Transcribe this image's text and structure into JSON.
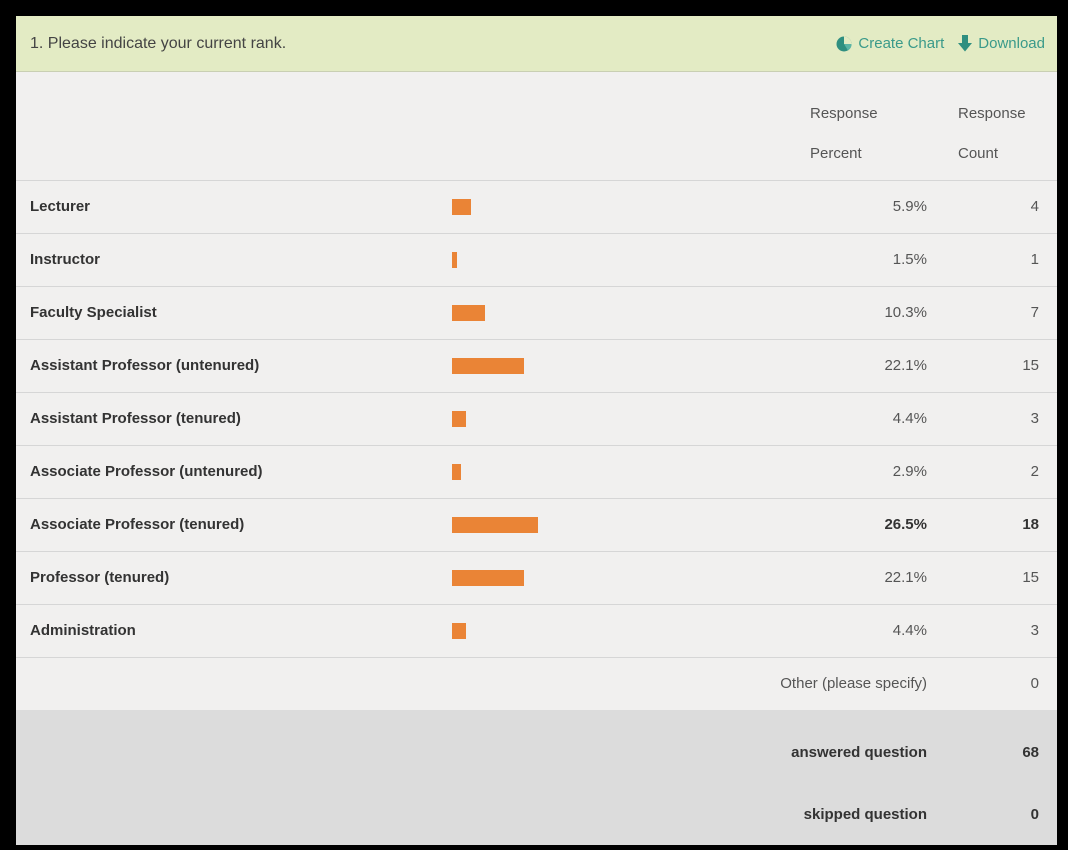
{
  "question": {
    "title": "1. Please indicate your current rank.",
    "actions": {
      "create_chart": "Create Chart",
      "download": "Download"
    }
  },
  "columns": {
    "percent_line1": "Response",
    "percent_line2": "Percent",
    "count_line1": "Response",
    "count_line2": "Count"
  },
  "rows": [
    {
      "label": "Lecturer",
      "percent": "5.9%",
      "count": "4",
      "value": 5.9
    },
    {
      "label": "Instructor",
      "percent": "1.5%",
      "count": "1",
      "value": 1.5
    },
    {
      "label": "Faculty Specialist",
      "percent": "10.3%",
      "count": "7",
      "value": 10.3
    },
    {
      "label": "Assistant Professor (untenured)",
      "percent": "22.1%",
      "count": "15",
      "value": 22.1
    },
    {
      "label": "Assistant Professor (tenured)",
      "percent": "4.4%",
      "count": "3",
      "value": 4.4
    },
    {
      "label": "Associate Professor (untenured)",
      "percent": "2.9%",
      "count": "2",
      "value": 2.9
    },
    {
      "label": "Associate Professor (tenured)",
      "percent": "26.5%",
      "count": "18",
      "value": 26.5,
      "highlight": true
    },
    {
      "label": "Professor (tenured)",
      "percent": "22.1%",
      "count": "15",
      "value": 22.1
    },
    {
      "label": "Administration",
      "percent": "4.4%",
      "count": "3",
      "value": 4.4
    }
  ],
  "other": {
    "label": "Other (please specify)",
    "count": "0"
  },
  "summary": {
    "answered_label": "answered question",
    "answered_value": "68",
    "skipped_label": "skipped question",
    "skipped_value": "0"
  },
  "colors": {
    "bar": "#ea8436",
    "header_bg": "#e3ebc4",
    "link": "#3a9a8a"
  }
}
